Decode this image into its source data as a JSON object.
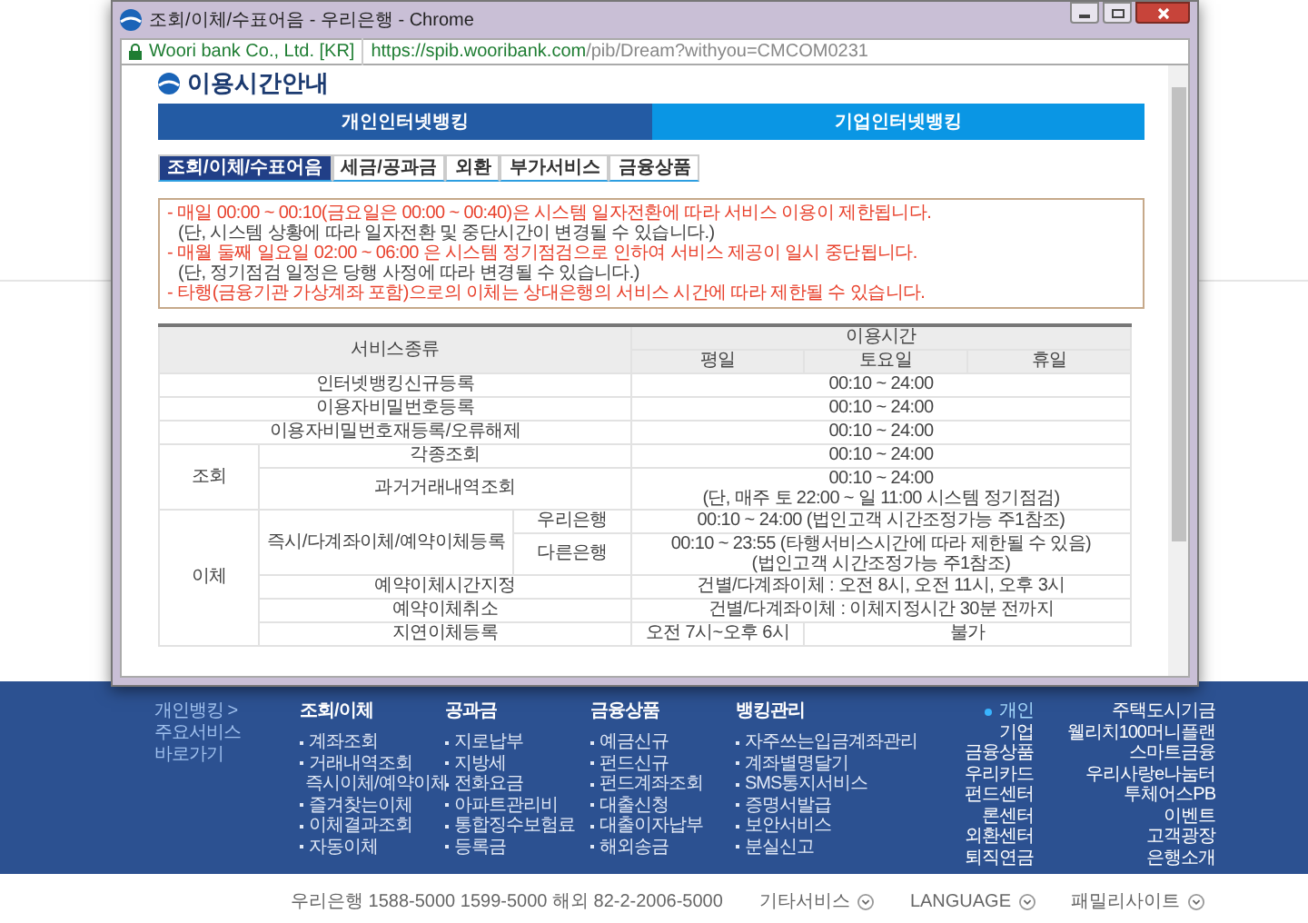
{
  "window": {
    "title": "조회/이체/수표어음 - 우리은행 - Chrome",
    "site_identity": "Woori bank Co., Ltd. [KR]",
    "url_host": "https://spib.wooribank.com",
    "url_path": "/pib/Dream?withyou=CMCOM0231"
  },
  "heading": "이용시간안내",
  "main_tabs": [
    {
      "label": "개인인터넷뱅킹",
      "selected": true
    },
    {
      "label": "기업인터넷뱅킹",
      "selected": false
    }
  ],
  "sub_tabs": [
    {
      "label": "조회/이체/수표어음",
      "selected": true
    },
    {
      "label": "세금/공과금",
      "selected": false
    },
    {
      "label": "외환",
      "selected": false
    },
    {
      "label": "부가서비스",
      "selected": false
    },
    {
      "label": "금융상품",
      "selected": false
    }
  ],
  "notices": [
    {
      "kind": "warning",
      "text": "- 매일 00:00 ~ 00:10(금요일은 00:00 ~ 00:40)은 시스템 일자전환에 따라 서비스 이용이 제한됩니다."
    },
    {
      "kind": "note",
      "text": "(단, 시스템 상황에 따라 일자전환 및 중단시간이 변경될 수 있습니다.)"
    },
    {
      "kind": "warning",
      "text": "- 매월 둘째 일요일 02:00 ~ 06:00 은 시스템 정기점검으로 인하여 서비스 제공이 일시 중단됩니다."
    },
    {
      "kind": "note",
      "text": "(단, 정기점검 일정은 당행 사정에 따라 변경될 수 있습니다.)"
    },
    {
      "kind": "warning",
      "text": "- 타행(금융기관 가상계좌 포함)으로의 이체는 상대은행의 서비스 시간에 따라 제한될 수 있습니다."
    }
  ],
  "table": {
    "header_rows": [
      [
        {
          "lines": [
            "서비스종류"
          ],
          "colspan": 3,
          "rowspan": 2
        },
        {
          "lines": [
            "이용시간"
          ],
          "colspan": 3
        }
      ],
      [
        {
          "lines": [
            "평일"
          ]
        },
        {
          "lines": [
            "토요일"
          ]
        },
        {
          "lines": [
            "휴일"
          ]
        }
      ]
    ],
    "rows": [
      [
        {
          "lines": [
            "인터넷뱅킹신규등록"
          ],
          "colspan": 3
        },
        {
          "lines": [
            "00:10 ~ 24:00"
          ],
          "colspan": 3
        }
      ],
      [
        {
          "lines": [
            "이용자비밀번호등록"
          ],
          "colspan": 3
        },
        {
          "lines": [
            "00:10 ~ 24:00"
          ],
          "colspan": 3
        }
      ],
      [
        {
          "lines": [
            "이용자비밀번호재등록/오류해제"
          ],
          "colspan": 3
        },
        {
          "lines": [
            "00:10 ~ 24:00"
          ],
          "colspan": 3
        }
      ],
      [
        {
          "lines": [
            "조회"
          ],
          "rowspan": 2
        },
        {
          "lines": [
            "각종조회"
          ],
          "colspan": 2
        },
        {
          "lines": [
            "00:10 ~ 24:00"
          ],
          "colspan": 3
        }
      ],
      [
        {
          "lines": [
            "과거거래내역조회"
          ],
          "colspan": 2
        },
        {
          "lines": [
            "00:10 ~ 24:00",
            "(단, 매주 토 22:00 ~ 일 11:00 시스템 정기점검)"
          ],
          "colspan": 3
        }
      ],
      [
        {
          "lines": [
            "이체"
          ],
          "rowspan": 5
        },
        {
          "lines": [
            "즉시/다계좌이체/예약이체등록"
          ],
          "rowspan": 2
        },
        {
          "lines": [
            "우리은행"
          ]
        },
        {
          "lines": [
            "00:10 ~ 24:00 (법인고객 시간조정가능 주1참조)"
          ],
          "colspan": 3
        }
      ],
      [
        {
          "lines": [
            "다른은행"
          ]
        },
        {
          "lines": [
            "00:10 ~ 23:55 (타행서비스시간에 따라 제한될 수 있음)",
            "(법인고객 시간조정가능 주1참조)"
          ],
          "colspan": 3
        }
      ],
      [
        {
          "lines": [
            "예약이체시간지정"
          ],
          "colspan": 2
        },
        {
          "lines": [
            "건별/다계좌이체 : 오전 8시, 오전 11시, 오후 3시"
          ],
          "colspan": 3
        }
      ],
      [
        {
          "lines": [
            "예약이체취소"
          ],
          "colspan": 2
        },
        {
          "lines": [
            "건별/다계좌이체 : 이체지정시간 30분 전까지"
          ],
          "colspan": 3
        }
      ],
      [
        {
          "lines": [
            "지연이체등록"
          ],
          "colspan": 2
        },
        {
          "lines": [
            "오전 7시~오후 6시"
          ]
        },
        {
          "lines": [
            "불가"
          ],
          "colspan": 2
        }
      ]
    ]
  },
  "footer": {
    "shortcut_link": "개인뱅킹 >",
    "shortcut_lines": [
      "주요서비스",
      "바로가기"
    ],
    "columns": [
      {
        "heading": "조회/이체",
        "items": [
          "계좌조회",
          "거래내역조회",
          "즉시이체/예약이체",
          "즐겨찾는이체",
          "이체결과조회",
          "자동이체"
        ]
      },
      {
        "heading": "공과금",
        "items": [
          "지로납부",
          "지방세",
          "전화요금",
          "아파트관리비",
          "통합징수보험료",
          "등록금"
        ]
      },
      {
        "heading": "금융상품",
        "items": [
          "예금신규",
          "펀드신규",
          "펀드계좌조회",
          "대출신청",
          "대출이자납부",
          "해외송금"
        ]
      },
      {
        "heading": "뱅킹관리",
        "items": [
          "자주쓰는입금계좌관리",
          "계좌별명달기",
          "SMS통지서비스",
          "증명서발급",
          "보안서비스",
          "분실신고"
        ]
      }
    ],
    "site_links": [
      {
        "label": "개인",
        "selected": true
      },
      {
        "label": "기업",
        "selected": false
      },
      {
        "label": "금융상품",
        "selected": false
      },
      {
        "label": "우리카드",
        "selected": false
      },
      {
        "label": "펀드센터",
        "selected": false
      },
      {
        "label": "론센터",
        "selected": false
      },
      {
        "label": "외환센터",
        "selected": false
      },
      {
        "label": "퇴직연금",
        "selected": false
      }
    ],
    "more_links": [
      "주택도시기금",
      "웰리치100머니플랜",
      "스마트금융",
      "우리사랑e나눔터",
      "투체어스PB",
      "이벤트",
      "고객광장",
      "은행소개"
    ]
  },
  "bottom_bar": {
    "contact": "우리은행 1588-5000 1599-5000 해외 82-2-2006-5000",
    "menus": [
      "기타서비스",
      "LANGUAGE",
      "패밀리사이트"
    ]
  }
}
